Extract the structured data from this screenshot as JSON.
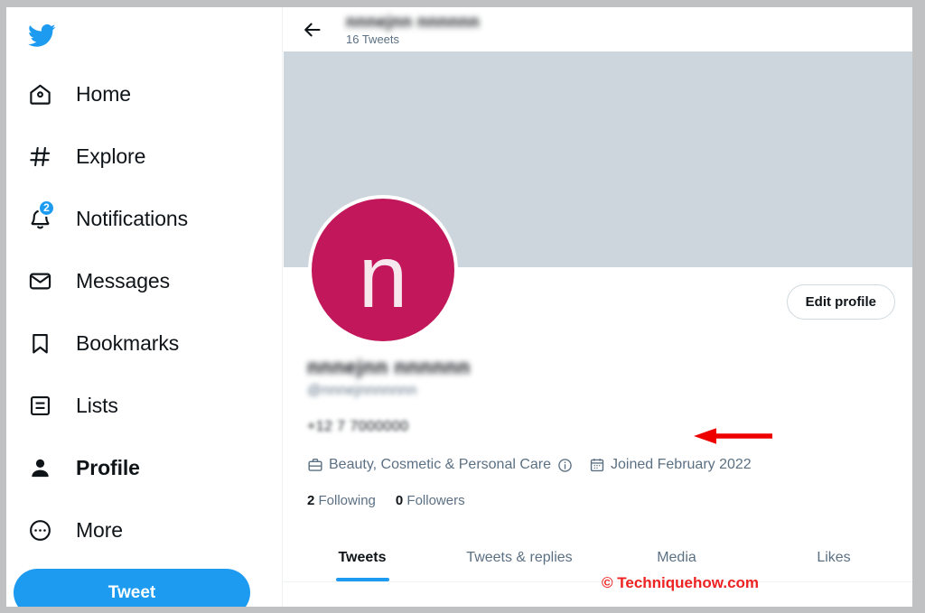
{
  "app": {
    "name": "Twitter",
    "logo_icon": "twitter-bird-icon"
  },
  "sidebar": {
    "items": [
      {
        "label": "Home",
        "icon": "home-icon",
        "active": false,
        "badge": null
      },
      {
        "label": "Explore",
        "icon": "hashtag-icon",
        "active": false,
        "badge": null
      },
      {
        "label": "Notifications",
        "icon": "bell-icon",
        "active": false,
        "badge": "2"
      },
      {
        "label": "Messages",
        "icon": "envelope-icon",
        "active": false,
        "badge": null
      },
      {
        "label": "Bookmarks",
        "icon": "bookmark-icon",
        "active": false,
        "badge": null
      },
      {
        "label": "Lists",
        "icon": "list-icon",
        "active": false,
        "badge": null
      },
      {
        "label": "Profile",
        "icon": "person-icon",
        "active": true,
        "badge": null
      },
      {
        "label": "More",
        "icon": "more-circle-icon",
        "active": false,
        "badge": null
      }
    ],
    "tweet_button_label": "Tweet"
  },
  "header": {
    "back_icon": "back-arrow-icon",
    "name": "nnnejnn nnnnnn",
    "tweet_count": "16 Tweets"
  },
  "profile": {
    "banner_color": "#cdd5dd",
    "avatar": {
      "letter": "n",
      "color": "#c2185b"
    },
    "edit_button_label": "Edit profile",
    "display_name": "nnnejnn nnnnnn",
    "handle": "@nnnejnnnnnnn",
    "phone": "+12 7 7000000",
    "category": "Beauty, Cosmetic & Personal Care",
    "category_icon": "briefcase-icon",
    "info_icon": "info-circle-icon",
    "joined": "Joined February 2022",
    "joined_icon": "calendar-icon",
    "following_count": "2",
    "following_label": "Following",
    "followers_count": "0",
    "followers_label": "Followers"
  },
  "tabs": [
    {
      "label": "Tweets",
      "active": true
    },
    {
      "label": "Tweets & replies",
      "active": false
    },
    {
      "label": "Media",
      "active": false
    },
    {
      "label": "Likes",
      "active": false
    }
  ],
  "annotation": {
    "arrow_color": "#ee0000",
    "arrow_icon": "left-arrow-annotation"
  },
  "watermark": {
    "text": "© Techniquehow.com",
    "color": "#ee2222"
  }
}
